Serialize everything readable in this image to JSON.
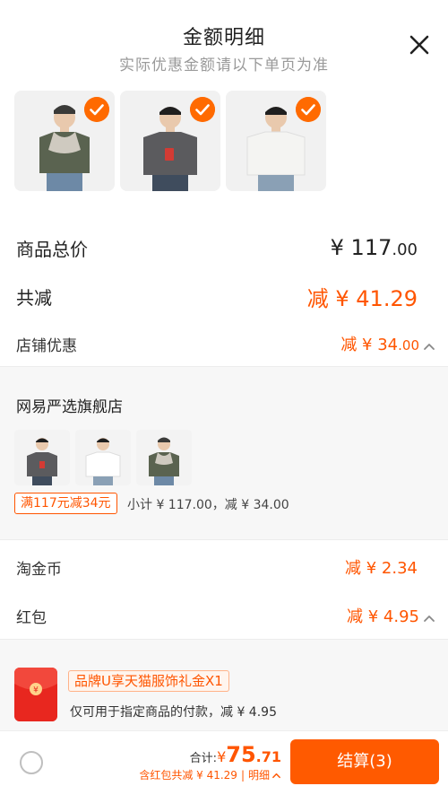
{
  "header": {
    "title": "金额明细",
    "subtitle": "实际优惠金额请以下单页为准"
  },
  "products": [
    {
      "name": "product-1",
      "selected": true,
      "shirt_color": "#5a6350",
      "accent_color": "#cfcac0"
    },
    {
      "name": "product-2",
      "selected": true,
      "shirt_color": "#5b5b5e",
      "accent_color": "#d33b34"
    },
    {
      "name": "product-3",
      "selected": true,
      "shirt_color": "#f4f4f2",
      "accent_color": "#8aa0b5"
    }
  ],
  "summary": {
    "total_label": "商品总价",
    "total_currency": "¥",
    "total_int": "117",
    "total_dec": ".00",
    "discount_label": "共减",
    "discount_value": "减 ¥ 41.29",
    "store_discount_label": "店铺优惠",
    "store_discount_prefix": "减 ¥ 34",
    "store_discount_dec": ".00"
  },
  "store": {
    "name": "网易严选旗舰店",
    "promo_tag": "满117元减34元",
    "subtotal": "小计 ¥ 117.00，减 ¥ 34.00",
    "items": [
      {
        "shirt_color": "#5b5b5e",
        "accent_color": "#d33b34"
      },
      {
        "shirt_color": "#f4f4f2",
        "accent_color": "#8aa0b5"
      },
      {
        "shirt_color": "#5a6350",
        "accent_color": "#cfcac0"
      }
    ]
  },
  "coins": {
    "label": "淘金币",
    "value": "减 ¥ 2.34"
  },
  "redpacket": {
    "label": "红包",
    "value": "减 ¥ 4.95",
    "voucher_tag": "品牌U享天猫服饰礼金X1",
    "voucher_desc": "仅可用于指定商品的付款，减 ¥ 4.95"
  },
  "footer": {
    "total_label": "合计:",
    "currency": "¥",
    "amount_int": "75",
    "amount_dec": ".71",
    "sub_text": "含红包共减 ¥ 41.29",
    "detail_label": "明细",
    "checkout_label": "结算(3)"
  },
  "colors": {
    "accent": "#ff5500",
    "checkout_bg": "#ff5a00",
    "check_badge": "#ff6a00",
    "redpack": "#e8271f"
  }
}
